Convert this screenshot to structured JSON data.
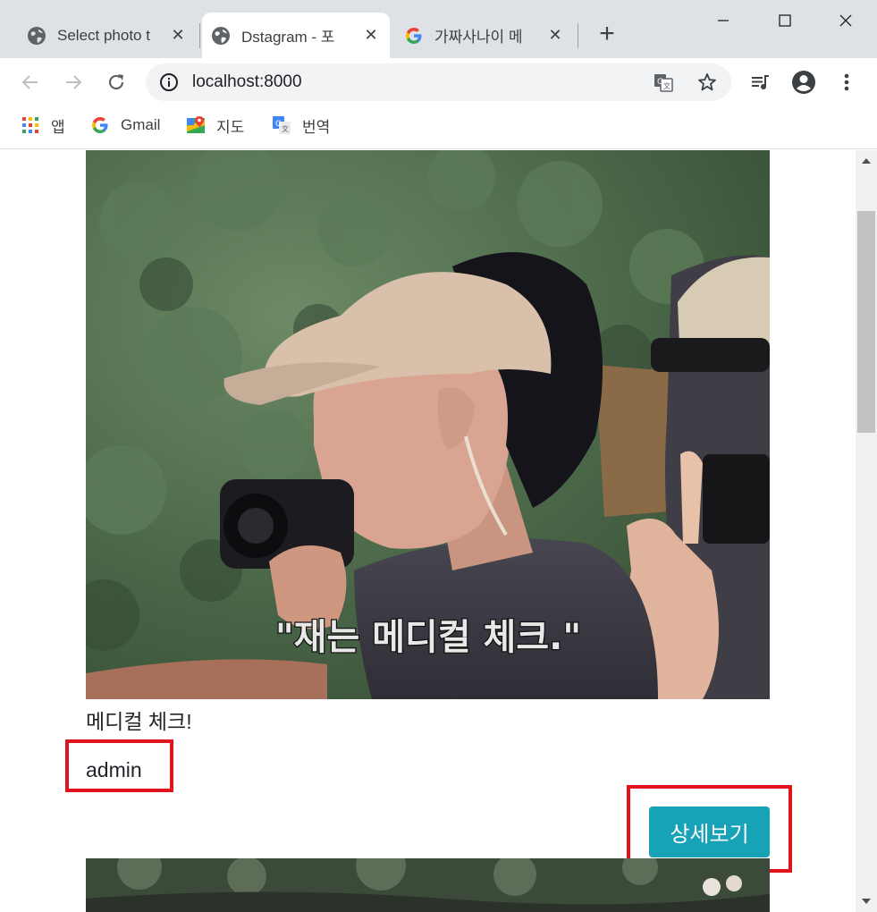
{
  "browser": {
    "tabs": [
      {
        "title": "Select photo t",
        "icon": "globe-icon",
        "active": false
      },
      {
        "title": "Dstagram - 포",
        "icon": "globe-icon",
        "active": true
      },
      {
        "title": "가짜사나이 메",
        "icon": "google-g-icon",
        "active": false
      }
    ],
    "new_tab_icon": "plus-icon",
    "window_controls": [
      "minimize-icon",
      "maximize-icon",
      "close-icon"
    ],
    "address": "localhost:8000",
    "bookmarks": [
      {
        "label": "앱",
        "icon": "apps-grid-icon"
      },
      {
        "label": "Gmail",
        "icon": "google-g-icon"
      },
      {
        "label": "지도",
        "icon": "google-maps-icon"
      },
      {
        "label": "번역",
        "icon": "google-translate-icon"
      }
    ]
  },
  "post": {
    "subtitle": "\"재는 메디컬 체크.\"",
    "caption": "메디컬 체크!",
    "author": "admin",
    "detail_button": "상세보기"
  },
  "colors": {
    "accent": "#17a2b8",
    "highlight": "#e1141d",
    "tabstrip": "#dee1e6"
  }
}
